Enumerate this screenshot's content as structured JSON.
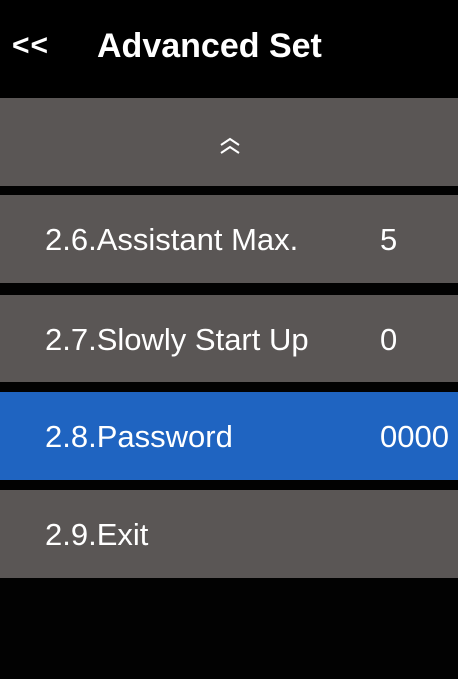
{
  "header": {
    "back_label": "<<",
    "title": "Advanced Set"
  },
  "scroll_up": {
    "icon": "double-chevron-up-icon"
  },
  "menu": [
    {
      "label": "2.6.Assistant Max.",
      "value": "5",
      "selected": false
    },
    {
      "label": "2.7.Slowly Start Up",
      "value": "0",
      "selected": false
    },
    {
      "label": "2.8.Password",
      "value": "0000",
      "selected": true
    },
    {
      "label": "2.9.Exit",
      "value": "",
      "selected": false
    }
  ],
  "colors": {
    "background": "#020202",
    "row": "#5a5655",
    "selected_row": "#1f64c1",
    "text": "#ffffff"
  }
}
